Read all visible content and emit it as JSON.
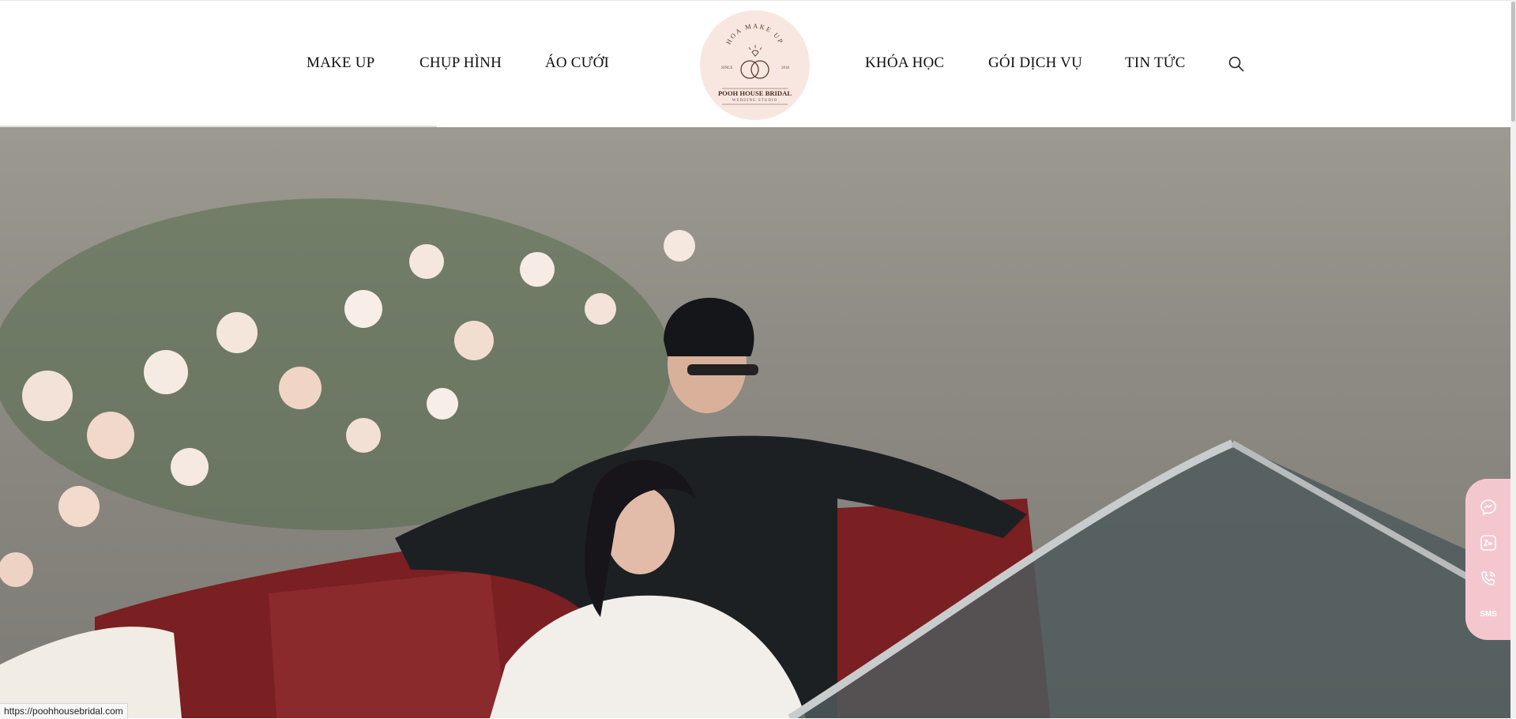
{
  "nav": {
    "left": [
      "MAKE UP",
      "CHỤP HÌNH",
      "ÁO CƯỚI"
    ],
    "right": [
      "KHÓA HỌC",
      "GÓI DỊCH VỤ",
      "TIN TỨC"
    ],
    "search_icon": "search-icon"
  },
  "logo": {
    "arc_text": "HOA MAKE UP",
    "since": "SINCE",
    "year": "2018",
    "brand": "POOH HOUSE BRIDAL",
    "sub": "WEDDING STUDIO",
    "background": "#f8e7e1"
  },
  "contact": {
    "background": "#f4c7cf",
    "items": [
      {
        "icon": "messenger-icon"
      },
      {
        "icon": "zalo-icon"
      },
      {
        "icon": "phone-icon"
      },
      {
        "icon": "sms-icon",
        "label": "SMS"
      }
    ]
  },
  "status_bar": {
    "url": "https://poohhousebridal.com"
  }
}
